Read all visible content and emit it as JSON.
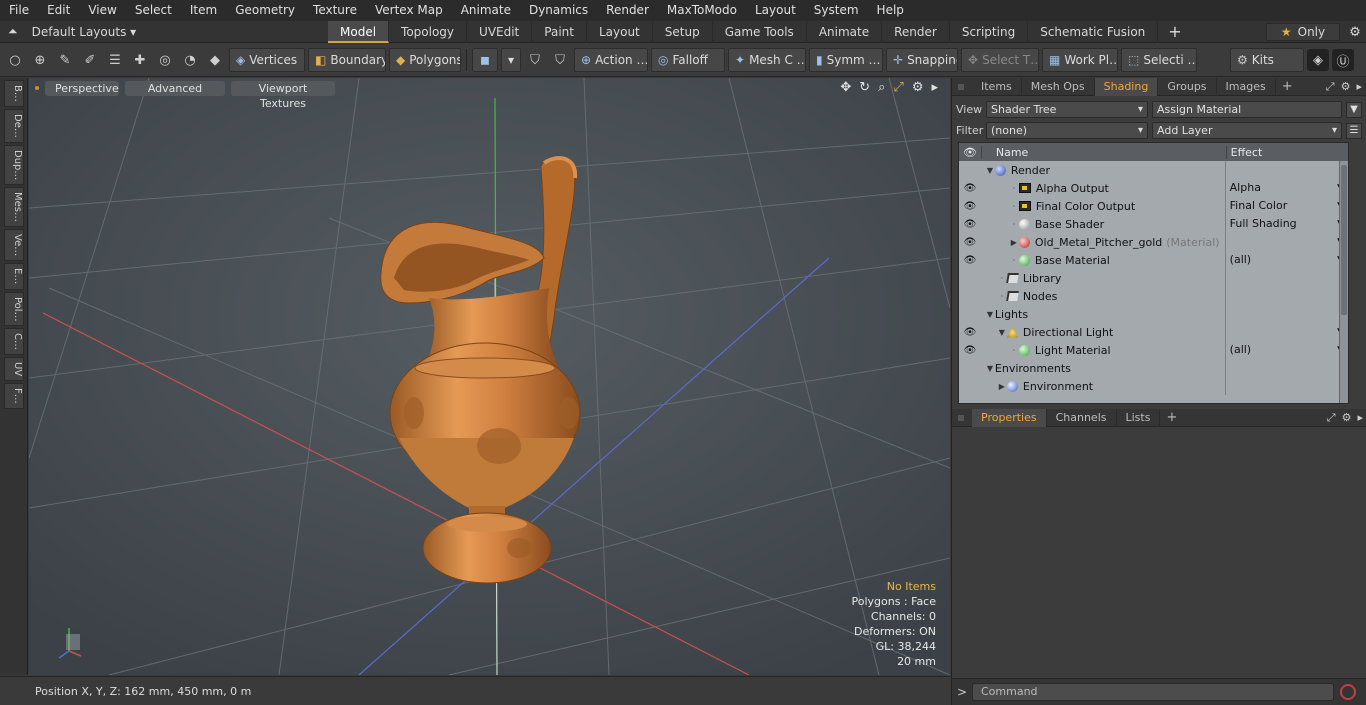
{
  "menu": [
    "File",
    "Edit",
    "View",
    "Select",
    "Item",
    "Geometry",
    "Texture",
    "Vertex Map",
    "Animate",
    "Dynamics",
    "Render",
    "MaxToModo",
    "Layout",
    "System",
    "Help"
  ],
  "layout": {
    "default_layouts": "Default Layouts ▾",
    "tabs": [
      "Model",
      "Topology",
      "UVEdit",
      "Paint",
      "Layout",
      "Setup",
      "Game Tools",
      "Animate",
      "Render",
      "Scripting",
      "Schematic Fusion"
    ],
    "active_tab": "Model",
    "plus": "+",
    "only": "Only"
  },
  "toolbar": {
    "vertices": "Vertices",
    "boundary": "Boundary",
    "polygons": "Polygons",
    "action": "Action …",
    "falloff": "Falloff",
    "mesh": "Mesh C …",
    "symm": "Symm …",
    "snapping": "Snapping",
    "select_t": "Select T…",
    "work_pl": "Work Pl…",
    "selecti": "Selecti …",
    "kits": "Kits"
  },
  "left_tabs": [
    "B…",
    "De…",
    "Dup…",
    "Mes…",
    "Ve…",
    "E…",
    "Pol…",
    "C…",
    "UV",
    "F…"
  ],
  "viewport": {
    "tabs": [
      "Perspective",
      "Advanced",
      "Viewport Textures"
    ],
    "info": {
      "no_items": "No Items",
      "polygons": "Polygons : Face",
      "channels": "Channels: 0",
      "deformers": "Deformers: ON",
      "gl": "GL: 38,244",
      "scale": "20 mm"
    }
  },
  "status": {
    "position": "Position X, Y, Z:   162 mm, 450 mm, 0 m"
  },
  "right_panel": {
    "tabs": [
      "Items",
      "Mesh Ops",
      "Shading",
      "Groups",
      "Images"
    ],
    "active_tab": "Shading",
    "plus": "+",
    "view_label": "View",
    "view_value": "Shader Tree",
    "assign_material": "Assign Material",
    "filter_label": "Filter",
    "filter_value": "(none)",
    "add_layer": "Add Layer",
    "tree_header": {
      "name": "Name",
      "effect": "Effect"
    },
    "tree": [
      {
        "name": "Render",
        "effect": "",
        "eye": false,
        "level": 0,
        "icon": "blue",
        "tri": "▼"
      },
      {
        "name": "Alpha Output",
        "effect": "Alpha",
        "eye": true,
        "level": 2,
        "icon": "img",
        "tri": ""
      },
      {
        "name": "Final Color Output",
        "effect": "Final Color",
        "eye": true,
        "level": 2,
        "icon": "img",
        "tri": ""
      },
      {
        "name": "Base Shader",
        "effect": "Full Shading",
        "eye": true,
        "level": 2,
        "icon": "grey",
        "tri": ""
      },
      {
        "name": "Old_Metal_Pitcher_gold",
        "suffix": "(Material)",
        "effect": "",
        "eye": true,
        "level": 2,
        "icon": "redgreen",
        "tri": "▶"
      },
      {
        "name": "Base Material",
        "effect": "(all)",
        "eye": true,
        "level": 2,
        "icon": "green",
        "tri": ""
      },
      {
        "name": "Library",
        "effect": "",
        "eye": false,
        "level": 1,
        "icon": "folder",
        "tri": ""
      },
      {
        "name": "Nodes",
        "effect": "",
        "eye": false,
        "level": 1,
        "icon": "folder",
        "tri": ""
      },
      {
        "name": "Lights",
        "effect": "",
        "eye": false,
        "level": 0,
        "icon": "",
        "tri": "▼"
      },
      {
        "name": "Directional Light",
        "effect": "",
        "eye": true,
        "level": 1,
        "icon": "light",
        "tri": "▼"
      },
      {
        "name": "Light Material",
        "effect": "(all)",
        "eye": true,
        "level": 2,
        "icon": "green",
        "tri": ""
      },
      {
        "name": "Environments",
        "effect": "",
        "eye": false,
        "level": 0,
        "icon": "",
        "tri": "▼"
      },
      {
        "name": "Environment",
        "effect": "",
        "eye": false,
        "level": 1,
        "icon": "env",
        "tri": "▶"
      }
    ],
    "bottom_tabs": [
      "Properties",
      "Channels",
      "Lists"
    ],
    "bottom_active": "Properties",
    "command_placeholder": "Command"
  },
  "colors": {
    "accent": "#f0a83a",
    "model_body": "#c97a3a",
    "viewport_bg": "#4a5156"
  }
}
